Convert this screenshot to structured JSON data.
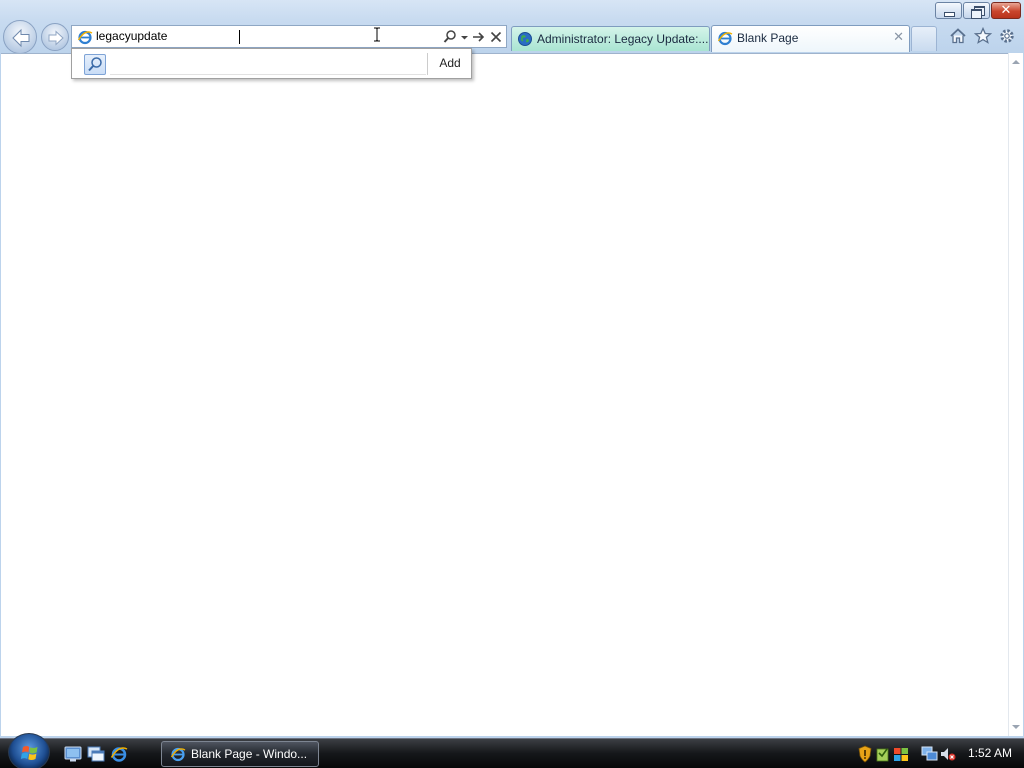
{
  "window": {
    "caption_buttons": [
      "minimize",
      "restore",
      "close"
    ],
    "close_glyph": "✕"
  },
  "navigation": {
    "back_icon": "back-arrow-icon",
    "forward_icon": "forward-arrow-icon"
  },
  "address_bar": {
    "value": "legacyupdate",
    "favicon": "ie-page-icon",
    "tools": [
      "search-icon",
      "dropdown-arrow-icon",
      "go-arrow-icon",
      "stop-icon"
    ],
    "stop_glyph": "✕"
  },
  "dropdown": {
    "search_icon": "search-icon",
    "add_label": "Add"
  },
  "tabs": [
    {
      "label": "Administrator: Legacy Update:...",
      "icon": "legacy-update-globe-icon",
      "active": false
    },
    {
      "label": "Blank Page",
      "icon": "ie-page-icon",
      "active": true,
      "close_glyph": "✕"
    }
  ],
  "toolbar": {
    "icons": [
      "home-icon",
      "favorites-star-icon",
      "tools-gear-icon"
    ]
  },
  "taskbar": {
    "start": "windows-start-orb",
    "quick_launch": [
      "show-desktop-icon",
      "switch-windows-icon",
      "internet-explorer-icon"
    ],
    "task_button_label": "Blank Page - Windo...",
    "tray_icons": [
      "security-shield-icon",
      "security-alert-icon",
      "action-center-flag-icon",
      "network-icon",
      "volume-muted-icon"
    ],
    "clock": "1:52 AM"
  },
  "colors": {
    "chrome": "#c8dbf0",
    "active_tab": "#ffffff",
    "inactive_tab": "#a9e4d2",
    "taskbar": "#16181b",
    "close_button": "#c9452d"
  }
}
